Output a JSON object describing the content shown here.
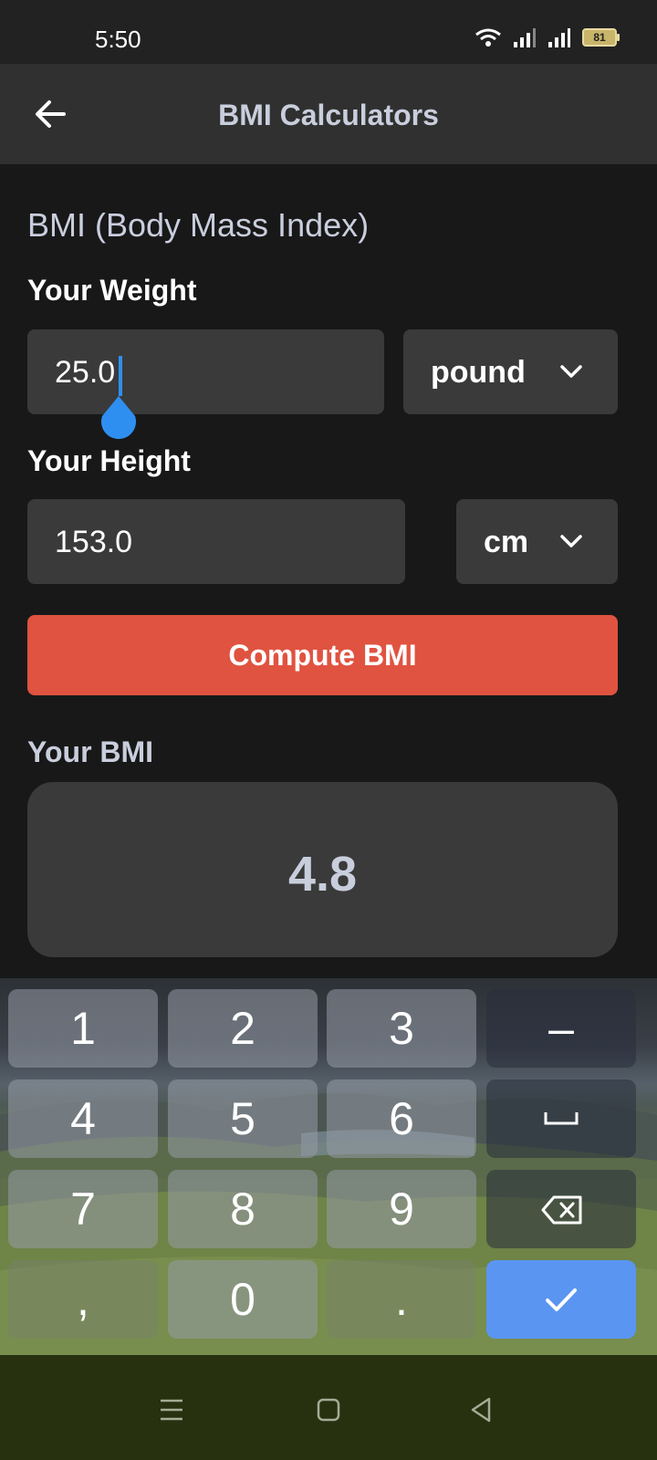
{
  "status_bar": {
    "time": "5:50",
    "battery": "81"
  },
  "app_bar": {
    "title": "BMI Calculators"
  },
  "form": {
    "section_title": "BMI (Body Mass Index)",
    "weight_label": "Your Weight",
    "weight_value": "25.0",
    "weight_unit": "pound",
    "height_label": "Your Height",
    "height_value": "153.0",
    "height_unit": "cm",
    "compute_label": "Compute BMI"
  },
  "result": {
    "label": "Your BMI",
    "value": "4.8"
  },
  "keyboard": {
    "keys": [
      "1",
      "2",
      "3",
      "–",
      "4",
      "5",
      "6",
      "␣",
      "7",
      "8",
      "9",
      "backspace",
      ",",
      "0",
      ".",
      "done"
    ],
    "labels": {
      "k1": "1",
      "k2": "2",
      "k3": "3",
      "minus": "–",
      "k4": "4",
      "k5": "5",
      "k6": "6",
      "k7": "7",
      "k8": "8",
      "k9": "9",
      "comma": ",",
      "k0": "0",
      "dot": "."
    }
  },
  "colors": {
    "accent_button": "#e05341",
    "confirm_key": "#5a95f2",
    "cursor": "#2f8ff0"
  }
}
